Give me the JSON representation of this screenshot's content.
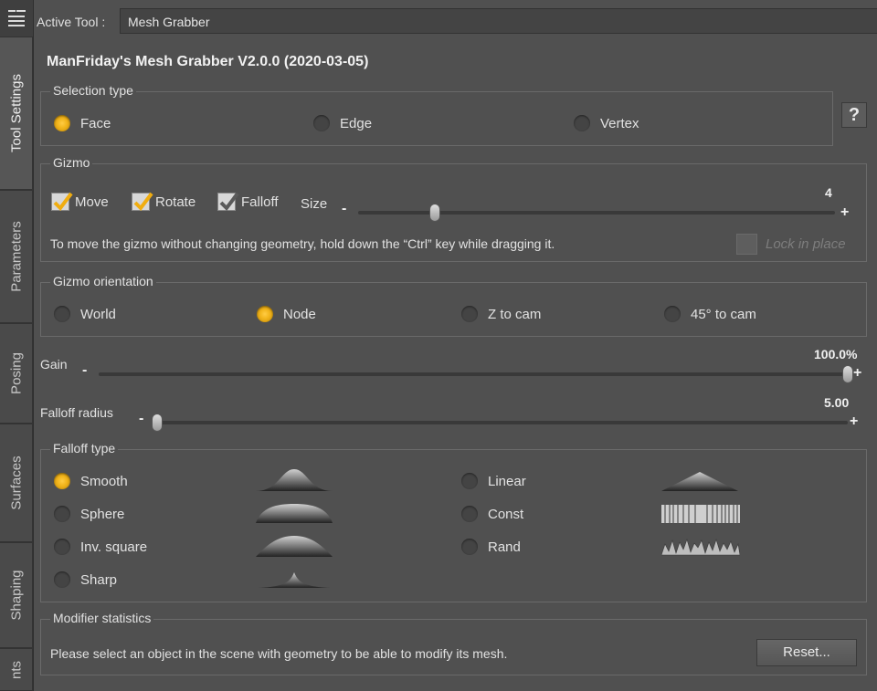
{
  "tabs": [
    {
      "label": "Tool Settings",
      "active": true
    },
    {
      "label": "Parameters",
      "active": false
    },
    {
      "label": "Posing",
      "active": false
    },
    {
      "label": "Surfaces",
      "active": false
    },
    {
      "label": "Shaping",
      "active": false
    },
    {
      "label": "nts",
      "active": false
    }
  ],
  "header": {
    "active_tool_label": "Active Tool :",
    "active_tool_value": "Mesh Grabber"
  },
  "title": "ManFriday's Mesh Grabber V2.0.0 (2020-03-05)",
  "help_label": "?",
  "selection_type": {
    "title": "Selection type",
    "options": [
      "Face",
      "Edge",
      "Vertex"
    ],
    "selected": "Face"
  },
  "gizmo": {
    "title": "Gizmo",
    "checks": [
      {
        "label": "Move",
        "checked": true,
        "style": "yellow"
      },
      {
        "label": "Rotate",
        "checked": true,
        "style": "yellow"
      },
      {
        "label": "Falloff",
        "checked": true,
        "style": "grey"
      }
    ],
    "size_label": "Size",
    "size_value": "4",
    "size_fraction": 0.16,
    "hint": "To move the gizmo without changing geometry, hold down the “Ctrl” key while dragging it.",
    "lock_label": "Lock in place"
  },
  "gizmo_orientation": {
    "title": "Gizmo orientation",
    "options": [
      "World",
      "Node",
      "Z to cam",
      "45° to cam"
    ],
    "selected": "Node"
  },
  "gain": {
    "label": "Gain",
    "value": "100.0%",
    "fraction": 1.0
  },
  "falloff_radius": {
    "label": "Falloff radius",
    "value": "5.00",
    "fraction": 0.0
  },
  "slider_minus": "-",
  "slider_plus": "+",
  "falloff_type": {
    "title": "Falloff type",
    "options": [
      "Smooth",
      "Sphere",
      "Inv. square",
      "Sharp",
      "Linear",
      "Const",
      "Rand"
    ],
    "selected": "Smooth"
  },
  "modifier_statistics": {
    "title": "Modifier statistics",
    "message": "Please select an object in the scene with geometry to be able to modify its mesh.",
    "reset_label": "Reset..."
  },
  "colors": {
    "accent": "#f2b51c",
    "panel": "#505050",
    "tabstrip": "#3f3f3f"
  }
}
